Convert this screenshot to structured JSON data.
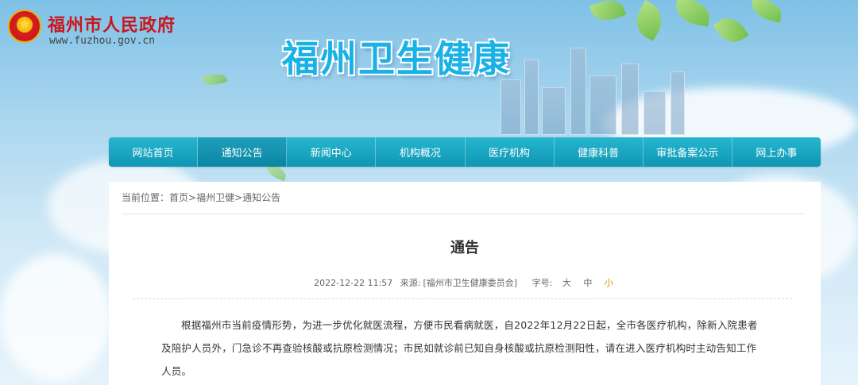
{
  "header": {
    "gov_name": "福州市人民政府",
    "gov_url": "www.fuzhou.gov.cn",
    "site_title": "福州卫生健康"
  },
  "nav": {
    "items": [
      {
        "label": "网站首页"
      },
      {
        "label": "通知公告"
      },
      {
        "label": "新闻中心"
      },
      {
        "label": "机构概况"
      },
      {
        "label": "医疗机构"
      },
      {
        "label": "健康科普"
      },
      {
        "label": "审批备案公示"
      },
      {
        "label": "网上办事"
      }
    ]
  },
  "breadcrumb": {
    "prefix": "当前位置：",
    "items": [
      "首页",
      "福州卫健",
      "通知公告"
    ],
    "separator": ">"
  },
  "article": {
    "title": "通告",
    "date": "2022-12-22 11:57",
    "source_label": "来源:",
    "source": "[福州市卫生健康委员会]",
    "font_label": "字号:",
    "font_large": "大",
    "font_medium": "中",
    "font_small": "小",
    "body": "根据福州市当前疫情形势，为进一步优化就医流程，方便市民看病就医，自2022年12月22日起，全市各医疗机构，除新入院患者及陪护人员外，门急诊不再查验核酸或抗原检测情况；市民如就诊前已知自身核酸或抗原检测阳性，请在进入医疗机构时主动告知工作人员。"
  },
  "colors": {
    "nav_bg": "#1aa6c2",
    "title_blue": "#19b2e6",
    "gov_red": "#c9171e",
    "font_small_active": "#e08a00"
  }
}
